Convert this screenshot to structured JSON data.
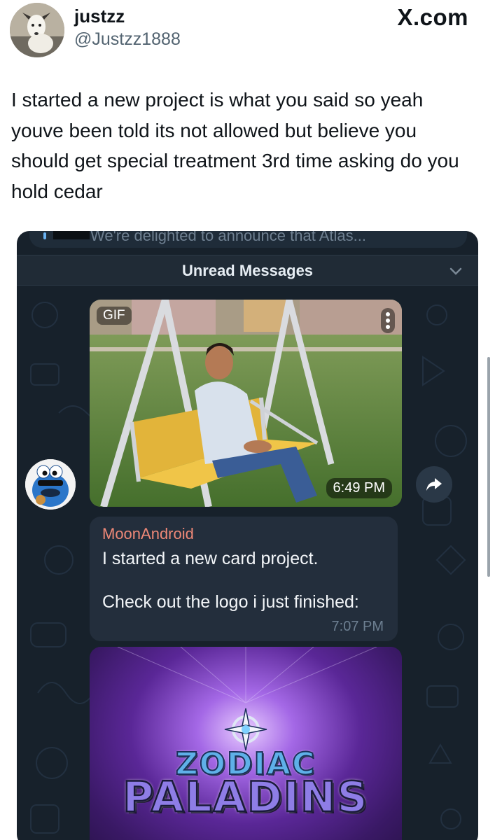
{
  "tweet": {
    "display_name": "justzz",
    "handle": "@Justzz1888",
    "platform_logo": "X.com",
    "text": "I started a new project is what you said so yeah youve been told its not allowed but believe you should get special treatment 3rd time asking do you hold cedar"
  },
  "embedded_chat": {
    "previous_message_preview": "We're delighted to announce that Atlas...",
    "unread_label": "Unread Messages",
    "gif": {
      "badge": "GIF",
      "time": "6:49 PM"
    },
    "message": {
      "sender": "MoonAndroid",
      "line1": "I started a new card project.",
      "line2": "Check out the logo i just finished:",
      "time": "7:07 PM"
    },
    "logo_image": {
      "line1": "ZODIAC",
      "line2": "PALADINS"
    }
  },
  "colors": {
    "chat_background": "#17212b",
    "bubble": "#232e3c",
    "sender_name": "#ee8877",
    "link_blue": "#6ab3f3"
  },
  "icons": [
    "x-logo",
    "chevron-down-icon",
    "share-arrow-icon",
    "more-dots-icon"
  ]
}
